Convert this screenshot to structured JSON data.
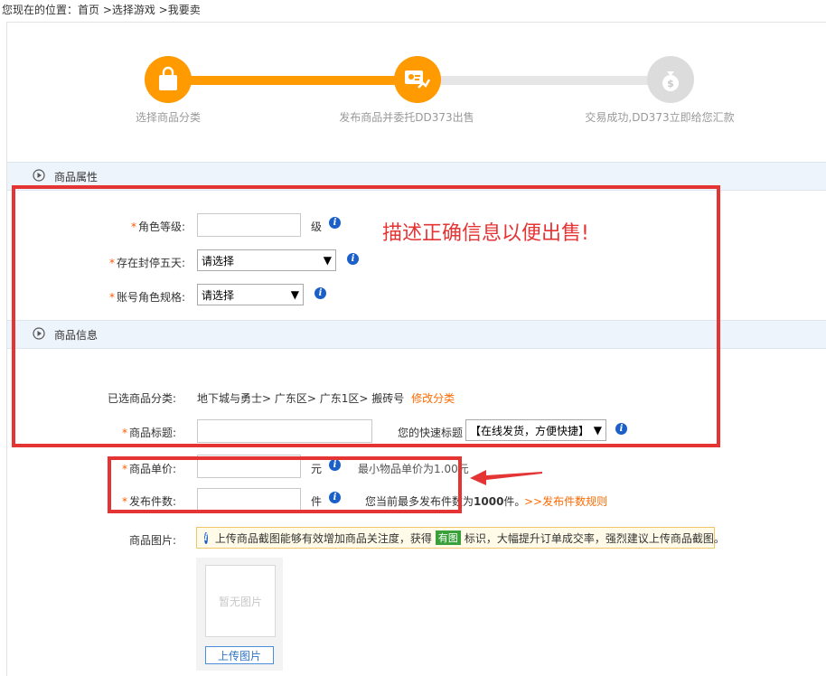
{
  "breadcrumb": "您现在的位置：首页 >选择游戏 >我要卖",
  "steps": [
    {
      "label": "选择商品分类",
      "state": "done",
      "icon": "shopping-bag-icon"
    },
    {
      "label": "发布商品并委托DD373出售",
      "state": "current",
      "icon": "publish-delegate-icon"
    },
    {
      "label": "交易成功,DD373立即给您汇款",
      "state": "pending",
      "icon": "money-bag-icon"
    }
  ],
  "sections": {
    "attributes": "商品属性",
    "info": "商品信息"
  },
  "attributes": {
    "level_label": "角色等级:",
    "level_value": "",
    "level_unit": "级",
    "banned_label": "存在封停五天:",
    "banned_value": "请选择",
    "spec_label": "账号角色规格:",
    "spec_value": "请选择"
  },
  "annotation_text": "描述正确信息以便出售!",
  "info": {
    "category_label": "已选商品分类:",
    "category_value": "地下城与勇士> 广东区> 广东1区> 搬砖号",
    "category_edit": "修改分类",
    "title_label": "商品标题:",
    "title_value": "",
    "quick_title_label": "您的快速标题",
    "quick_title_value": "【在线发货，方便快捷】",
    "price_label": "商品单价:",
    "price_value": "",
    "price_unit": "元",
    "price_hint": "最小物品单价为1.00元",
    "qty_label": "发布件数:",
    "qty_value": "",
    "qty_unit": "件",
    "qty_hint_pre": "您当前最多发布件数为",
    "qty_hint_num": "1000",
    "qty_hint_post": "件。",
    "qty_rule_link": ">>发布件数规则",
    "image_label": "商品图片:",
    "notice_pre": "上传商品截图能够有效增加商品关注度，获得",
    "notice_tag": "有图",
    "notice_post": "标识，大幅提升订单成交率，强烈建议上传商品截图。",
    "no_image": "暂无图片",
    "upload_button": "上传图片"
  },
  "colors": {
    "accent_orange": "#ff9900",
    "annotation_red": "#e53434",
    "link_orange": "#ff6a00",
    "info_blue": "#1b5fc9"
  }
}
